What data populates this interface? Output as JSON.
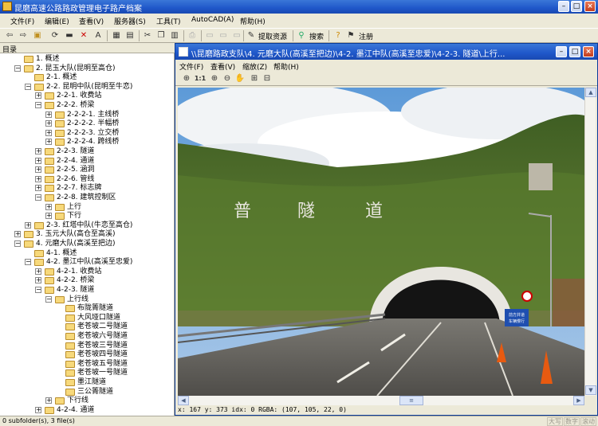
{
  "window": {
    "title": "昆磨高速公路路政管理电子路产档案"
  },
  "menubar": {
    "items": [
      "文件(F)",
      "编辑(E)",
      "查看(V)",
      "服务器(S)",
      "工具(T)",
      "AutoCAD(A)",
      "帮助(H)"
    ]
  },
  "toolbar": {
    "extract_label": "提取资源",
    "search_label": "搜索",
    "logout_label": "注册"
  },
  "tree": {
    "header": "目录",
    "nodes": [
      {
        "label": "1. 概述",
        "level": 1,
        "expander": ""
      },
      {
        "label": "2. 昆玉大队(昆明至高仓)",
        "level": 1,
        "expander": "-"
      },
      {
        "label": "2-1. 概述",
        "level": 2,
        "expander": ""
      },
      {
        "label": "2-2. 昆明中队(昆明至牛恋)",
        "level": 2,
        "expander": "-"
      },
      {
        "label": "2-2-1. 收费站",
        "level": 3,
        "expander": "+"
      },
      {
        "label": "2-2-2. 桥梁",
        "level": 3,
        "expander": "-"
      },
      {
        "label": "2-2-2-1. 主线桥",
        "level": 4,
        "expander": "+"
      },
      {
        "label": "2-2-2-2. 半幅桥",
        "level": 4,
        "expander": "+"
      },
      {
        "label": "2-2-2-3. 立交桥",
        "level": 4,
        "expander": "+"
      },
      {
        "label": "2-2-2-4. 跨线桥",
        "level": 4,
        "expander": "+"
      },
      {
        "label": "2-2-3. 隧道",
        "level": 3,
        "expander": "+"
      },
      {
        "label": "2-2-4. 通道",
        "level": 3,
        "expander": "+"
      },
      {
        "label": "2-2-5. 涵洞",
        "level": 3,
        "expander": "+"
      },
      {
        "label": "2-2-6. 管线",
        "level": 3,
        "expander": "+"
      },
      {
        "label": "2-2-7. 标志牌",
        "level": 3,
        "expander": "+"
      },
      {
        "label": "2-2-8. 建筑控制区",
        "level": 3,
        "expander": "-"
      },
      {
        "label": "上行",
        "level": 4,
        "expander": "+"
      },
      {
        "label": "下行",
        "level": 4,
        "expander": "+"
      },
      {
        "label": "2-3. 红塔中队(牛恋至高仓)",
        "level": 2,
        "expander": "+"
      },
      {
        "label": "3. 玉元大队(高仓至高溪)",
        "level": 1,
        "expander": "+"
      },
      {
        "label": "4. 元磨大队(高溪至把边)",
        "level": 1,
        "expander": "-"
      },
      {
        "label": "4-1. 概述",
        "level": 2,
        "expander": ""
      },
      {
        "label": "4-2. 墨江中队(高溪至忠爱)",
        "level": 2,
        "expander": "-"
      },
      {
        "label": "4-2-1. 收费站",
        "level": 3,
        "expander": "+"
      },
      {
        "label": "4-2-2. 桥梁",
        "level": 3,
        "expander": "+"
      },
      {
        "label": "4-2-3. 隧道",
        "level": 3,
        "expander": "-"
      },
      {
        "label": "上行线",
        "level": 4,
        "expander": "-"
      },
      {
        "label": "布陇箐隧道",
        "level": 5,
        "expander": ""
      },
      {
        "label": "大风垭口隧道",
        "level": 5,
        "expander": ""
      },
      {
        "label": "老苍坡二号隧道",
        "level": 5,
        "expander": ""
      },
      {
        "label": "老苍坡六号隧道",
        "level": 5,
        "expander": ""
      },
      {
        "label": "老苍坡三号隧道",
        "level": 5,
        "expander": ""
      },
      {
        "label": "老苍坡四号隧道",
        "level": 5,
        "expander": ""
      },
      {
        "label": "老苍坡五号隧道",
        "level": 5,
        "expander": ""
      },
      {
        "label": "老苍坡一号隧道",
        "level": 5,
        "expander": ""
      },
      {
        "label": "墨江隧道",
        "level": 5,
        "expander": ""
      },
      {
        "label": "三公箐隧道",
        "level": 5,
        "expander": ""
      },
      {
        "label": "下行线",
        "level": 4,
        "expander": "+"
      },
      {
        "label": "4-2-4. 通道",
        "level": 3,
        "expander": "+"
      }
    ]
  },
  "viewer": {
    "title": "\\\\昆磨路政支队\\4. 元磨大队(高溪至把边)\\4-2. 墨江中队(高溪至忠爱)\\4-2-3. 隧道\\上行...",
    "menu": [
      "文件(F)",
      "查看(V)",
      "缩放(Z)",
      "帮助(H)"
    ],
    "zoom_1to1": "1:1",
    "pixel_info": "x: 167 y: 373  idx: 0   RGBA: (107, 105, 22, 0)",
    "photo": {
      "tunnel_lettering": [
        "普",
        "隧",
        "道"
      ],
      "sign_text": [
        "前方并道",
        "车辆慢行"
      ]
    }
  },
  "statusbar": {
    "text": "0 subfolder(s), 3 file(s)",
    "indicators": [
      "大写",
      "数字",
      "滚动"
    ]
  }
}
